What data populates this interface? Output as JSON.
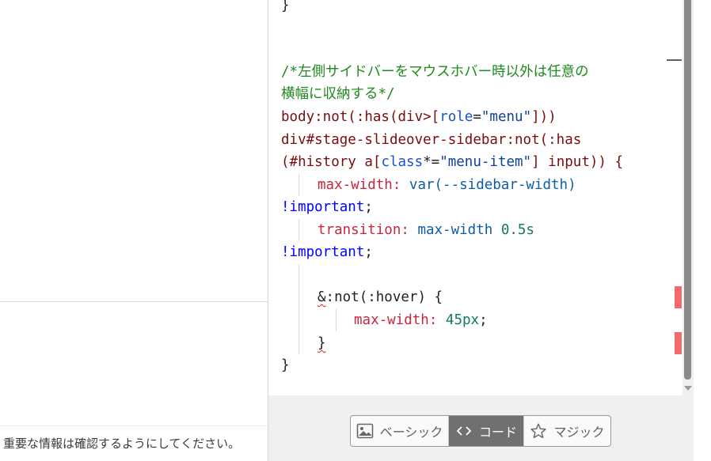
{
  "left_pane": {
    "footer_text": "重要な情報は確認するようにしてください。"
  },
  "editor": {
    "line_closing_brace_top": "}",
    "comment_line1": "/*左側サイドバーをマウスホバー時以外は任意の",
    "comment_line2": "横幅に収納する*/",
    "selector_line1": {
      "p1": "body:not(:has(div>[",
      "attr": "role",
      "p2": "=",
      "str": "\"menu\"",
      "p3": "]))"
    },
    "selector_line2": "div#stage-slideover-sidebar:not(:has",
    "selector_line3": {
      "p1": "(#history a[",
      "attr": "class",
      "p2": "*=",
      "str": "\"menu-item\"",
      "p3": "] input)) {"
    },
    "decl1": {
      "prop": "max-width:",
      "val": "var(--sidebar-width)",
      "important": "!important",
      "semi": ";"
    },
    "decl2": {
      "prop": "transition:",
      "val": "max-width",
      "num": "0.5s",
      "important": "!important",
      "semi": ";"
    },
    "nested_selector": {
      "amp": "&",
      "rest": ":not(:hover) {"
    },
    "decl3": {
      "prop": "max-width:",
      "num": "45px",
      "semi": ";"
    },
    "nested_close": "}",
    "rule_close": "}"
  },
  "toolbar": {
    "buttons": [
      {
        "label": "ベーシック",
        "icon": "image-icon",
        "active": false
      },
      {
        "label": "コード",
        "icon": "code-brackets-icon",
        "active": true
      },
      {
        "label": "マジック",
        "icon": "star-icon",
        "active": false
      }
    ]
  },
  "colors": {
    "comment": "#1d8a1d",
    "selector": "#7a0d0d",
    "property": "#c8263f",
    "important": "#0000ff",
    "number": "#0f7a5e",
    "active_button": "#707070",
    "error_marker": "#f26b6b"
  }
}
